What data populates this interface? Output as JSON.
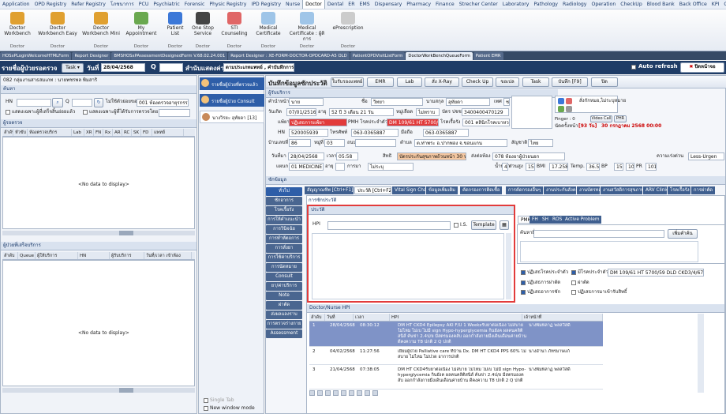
{
  "menu": [
    "Application",
    "OPD Registry",
    "Refer Registry",
    "โภชนาการ",
    "PCU",
    "Psychiatric",
    "Forensic",
    "Physic Registry",
    "IPD Registry",
    "Nurse",
    "Doctor",
    "Dental",
    "ER",
    "EMS",
    "Dispensary",
    "Pharmacy",
    "Finance",
    "Strecher Center",
    "Laboratory",
    "Pathology",
    "Radiology",
    "Operation",
    "CheckUp",
    "Blood Bank",
    "Back Office",
    "KPI",
    "GIS",
    "HHC",
    "Tools"
  ],
  "menu_active": "Doctor",
  "ribbon": [
    {
      "label": "Doctor Workbench",
      "group": "Doctor",
      "color": "#e0a030"
    },
    {
      "label": "Doctor Workbench Easy",
      "group": "Doctor",
      "color": "#e0a030"
    },
    {
      "label": "Doctor Workbench Mini",
      "group": "Doctor",
      "color": "#e0a030"
    },
    {
      "label": "My Appointment",
      "group": "Doctor",
      "color": "#6aa84f"
    },
    {
      "label": "Patient List",
      "group": "Doctor",
      "color": "#3c78d8"
    },
    {
      "label": "One Stop Service",
      "group": "Doctor",
      "color": "#444444"
    },
    {
      "label": "STI Counseling",
      "group": "Doctor",
      "color": "#e06666"
    },
    {
      "label": "Medical Certificate",
      "group": "Doctor",
      "color": "#9fc5e8"
    },
    {
      "label": "Medical Certificate : ผู้ติการ",
      "group": "Doctor",
      "color": "#9fc5e8"
    },
    {
      "label": "ePrescription",
      "group": "Doctor",
      "color": "#cccccc"
    }
  ],
  "doc_tabs": [
    "HOSxPLoginWelcomeHTMLForm",
    "Report Designer",
    "BMSHOSxPAssessmentDesignedForm V.68.02.24.001",
    "Report Designer : XE-FORM-DOCTOR-OPDCARD-A5 OLD",
    "PatientOPDVisitListForm",
    "DoctorWorkBenchQueueForm",
    "Patient EMR"
  ],
  "doc_tab_active": "DoctorWorkBenchQueueForm",
  "title": {
    "left": "รายชื่อผู้ป่วยรอตรวจ",
    "task": "Task",
    "date_label": "วันที่",
    "date": "28/04/2568",
    "q": "Q",
    "display_label": "สำนับแสดงค่า",
    "display_value": "ตามประเภทแพทย์ , คำบันทึกการ",
    "auto_refresh": "Auto refresh",
    "close_label": "ปิดหน้าจอ"
  },
  "left": {
    "room": "082 กลุ่มงานสาธสมเภท : นายพชรพล พิมสาริ",
    "search_title": "ค้นหา",
    "hn_label": "HN",
    "q_label": "Q",
    "show_from": "ไม่ใช้ตัวย่อยของ",
    "room_value": "001 ห้องตรวจอายุรกรรม",
    "opt1": "แสดงเฉพาะผู้ที่เสร็จสิ้นย่อยแล้ว",
    "opt2": "แสดงเฉพาะผู้ที่ได้รับการตรวจโดย",
    "waiting_title": "ผู้รอตรวจ",
    "cols": [
      "ลำดับ",
      "หัวขับ",
      "ห้องตรวจบริกร",
      "Lab",
      "XR",
      "FN",
      "Rx",
      "AR",
      "RC",
      "SK",
      "FD",
      "แพทย์"
    ],
    "nodata": "<No data to display>",
    "done_title": "ผู้ป่วยที่เสร็จบริการ",
    "done_cols": [
      "ลำดับ",
      "Queue",
      "ผู้ให้บริการ",
      "HN",
      "ผู้รับบริการ",
      "วันที่/เวลา เข้าห้อง"
    ],
    "single_tab": "Single Tab",
    "new_window": "New window mode"
  },
  "mid": {
    "items": [
      "รายชื่อผู้ป่วยที่ตรวจแล้ว",
      "รายชื่อผู้ป่วย Consult"
    ],
    "patient": "นางวิรยะ อุทัยดา [13]"
  },
  "main": {
    "heading": "บันทึกข้อมูลซักประวัติ",
    "toolbar": [
      "ใบรับรองแพทย์",
      "EMR",
      "Lab",
      "สั่ง X-Ray",
      "Check Up",
      "ขอเปล",
      "Task",
      "บันทึก [F9]",
      "ปิด"
    ],
    "section1": "ผู้รับบริการ",
    "prefix_label": "คำนำหน้า",
    "prefix": "นาย",
    "fname_label": "ชื่อ",
    "fname": "วิทยา",
    "lname_label": "นามสกุล",
    "lname": "อุทัยดา",
    "sex_label": "เพศ",
    "sex": "ชาย",
    "birth_label": "วันเกิด",
    "birth": "07/01/2516",
    "age_label": "อายุ",
    "age": "52 ปี 3 เดือน 21 วัน",
    "blood_label": "หมู่เลือด",
    "blood": "ไม่ทราบ",
    "cid_label": "บัตร ปชช.",
    "cid": "3400400470129",
    "allergy_label": "แพ้ยา",
    "allergy": "ปฏิเสธการแพ้ยา",
    "pmh_label": "PMH โรคประจำตัว",
    "pmh": "DM 109/61 HT 5700/59 DLD CKD",
    "clinic_label": "โรคเรื้อรัง",
    "clinic": "001 คลินิกโรคเบาหวาน",
    "hn_label": "HN",
    "hn": "520005939",
    "phone_label": "โทรศัพท์",
    "phone": "063-0365887",
    "mobile_label": "มือถือ",
    "mobile": "063-0365887",
    "addr_label": "บ้านเลขที่",
    "addr": "86",
    "moo_label": "หมู่ที่",
    "moo": "03",
    "road_label": "ถนน",
    "district_label": "ตำบล",
    "district": "ต.ท่าพระ อ.ปากพอง จ.ขอนแกน",
    "nation_label": "สัญชาติ",
    "nation": "ไทย",
    "right_title": "สั่งกักหมอ,ไม่ระบุหมาย",
    "finger": "Finger : 0",
    "videocall": "Video Call",
    "phr": "PHR",
    "appt_label": "นัดครั้งหน้า",
    "appt_days": "[93 วัน]",
    "appt_date": "30 กรกฎาคม 2568 00:00",
    "visit_date_label": "วันที่มา",
    "visit_date": "28/04/2568",
    "time_label": "เวลา",
    "time": "05:58",
    "right_label": "สิทธิ",
    "right": "บัตรประกันสุขภาพถ้วนหน้า 30 บาท",
    "send_label": "ส่งต่อห้อง",
    "send": "078 ห้องยาผู้ป่วยนอก",
    "serious_label": "ความเร่งด่วน",
    "serious": "Less-Urgen",
    "dept_label": "แผนก",
    "dept": "01 MEDICINE",
    "age2_label": "อายุ",
    "marriage_label": "การมา",
    "marriage": "ไม่ระบุ",
    "weight_label": "น้ำหนัก",
    "weight": "42",
    "height_label": "ส่วนสูง",
    "height": "156",
    "bmi_label": "BMI",
    "bmi": "17.258",
    "temp_label": "Temp.",
    "temp": "36.5",
    "bp_label": "BP",
    "bp1": "150",
    "bp2": "100",
    "pr_label": "PR",
    "pr": "101",
    "section2": "ซักข้อมูล",
    "side": [
      "ทั่วไป",
      "ซักอาการ",
      "โรคเรื้อรัง",
      "การให้คำแนะนำ",
      "การวินิจฉัย",
      "การทำหัตถการ",
      "การสั่งยา",
      "การใช้ค่าบริการ",
      "การนัดหมาย",
      "Consult",
      "ยา/ค่าบริการ",
      "Note",
      "ผ่าตัด",
      "ส่งผลแลงราบ",
      "การตรวจร่างกาย",
      "Assessment"
    ],
    "tabs": [
      "สัญญาณชีพ [Ctrl+F1]",
      "ประวัติ [Ctrl+F2]",
      "Vital Sign Chart",
      "ข้อมูลเพิ่มเติม",
      "คัดกรองการติดเชื้อ",
      "การคัดกรองอื่นๆ",
      "งานประกันสังคม",
      "งานบัตรทอง",
      "งานสวัสดิการสุขภาพ",
      "ARV Clinic",
      "โรคเรื้อรัง",
      "การผ่าตัด"
    ],
    "tab_active": "ประวัติ [Ctrl+F2]",
    "hx_title": "การซักประวัติ",
    "hx_sub": "ประวัติ",
    "hpi_label": "HPI",
    "is_label": "I.S.",
    "template": "Template",
    "right_tabs": [
      "PMH",
      "FH",
      "SH",
      "ROS",
      "Active Problem"
    ],
    "lookup_label": "ค้นหาผื่น",
    "add_btn": "เพิ่มคำค้น",
    "checks": [
      {
        "label": "ปฏิเสธโรคประจำตัว",
        "on": true
      },
      {
        "label": "มีโรคประจำตัว",
        "on": true
      },
      {
        "label": "ปฏิเสธการผ่าตัด",
        "on": true
      },
      {
        "label": "ผ่าตัด",
        "on": false
      },
      {
        "label": "ปฏิเสธอาการชัก",
        "on": true
      },
      {
        "label": "ปฏิเสธการมาเข้ารับสิทธิ์",
        "on": false
      }
    ],
    "pmh_value": "DM 109/61 HT 5700/59 DLD CKD3/4/67  Epi",
    "dn_title": "Doctor/Nurse HPI",
    "grid_cols": [
      "ลำดับ",
      "วันที่",
      "เวลา",
      "HPI",
      "เจ้าหน้าที่"
    ],
    "rows": [
      {
        "n": "1",
        "d": "28/04/2568",
        "t": "08:30:12",
        "hpi": "DM HT CKD4 Epilepsy AKI F/U 1 Weeksรับยาต่อเนื่อง ไม่สบาย ไม่ไหม ไม่เบ ไม่มี sign Hypo-hyperglycemia กินยังค ผลคนคลิติสนิส์ ค้นข่า 2.4ป/ย มีสตรมองคลับ ออกกำลังกายมืงเดินเดือนค่ายบ้าน ดีคงความ T8 ปกติ 2 Q ปกติ",
        "s": "นางพิมพ์ลาฏ พลสวัสดิ์",
        "sel": true
      },
      {
        "n": "2",
        "d": "04/02/2568",
        "t": "11:27:56",
        "hpi": "เยียมผู้ป่วย Palliative care ที่บ้าน Dx. DM HT CKD4 PPS 60% ไม่สบาย ไม่ไหม ไม่ปวด อาการปกติ",
        "s": "นางอำนา ภัทรมาษแก้",
        "sel": false
      },
      {
        "n": "3",
        "d": "21/04/2568",
        "t": "07:38:05",
        "hpi": "DM HT CKD4รับยาต่อเนื่อง ไม่สบาย ไม่ไหม ไม่เบ ไม่มี sign Hypo-hyperglycemia กินยังค ผลคนคลิติสนิส์ ค้นข่า 2.4ป/ย มีสตรมองคลับ ออกกำลังกายมืงเดินเดือนค่ายบ้าน ดีคงความ T8 ปกติ 2 Q ปกติ",
        "s": "นางพิมพ์ลาฏ พลสวัสดิ์",
        "sel": false
      }
    ]
  },
  "colors": {
    "header_dark": "#1f3c66",
    "accent": "#2e5ea8",
    "highlight": "#e23b3b",
    "selected": "#7f93c7",
    "warn": "#f4c7a1"
  }
}
